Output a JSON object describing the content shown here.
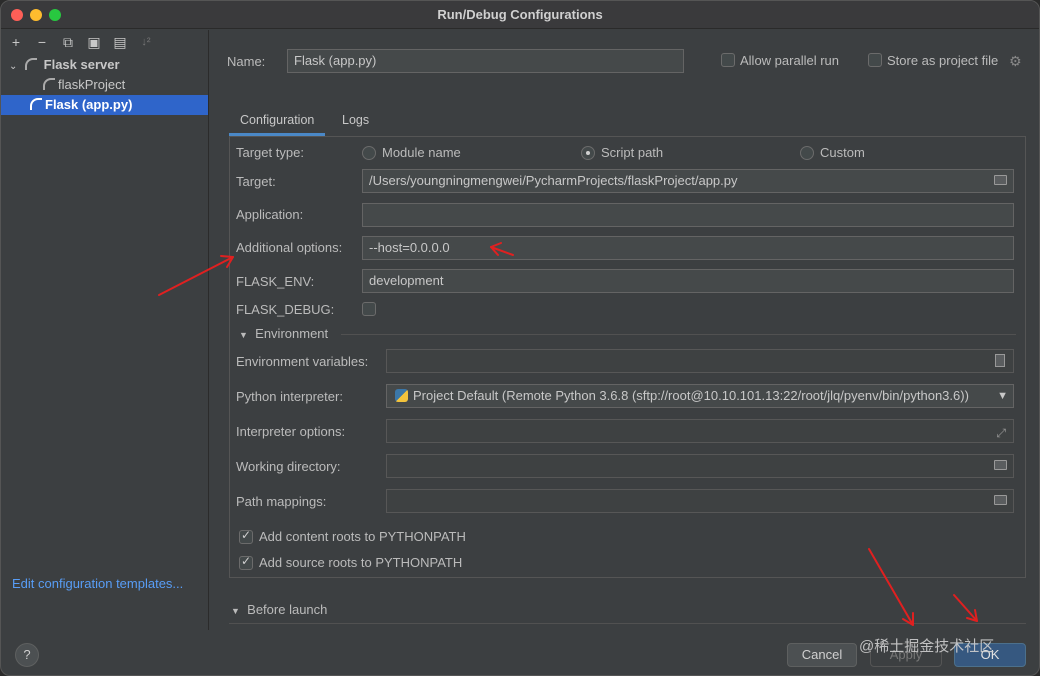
{
  "window": {
    "title": "Run/Debug Configurations"
  },
  "toolbar": {
    "icons": [
      "plus-icon",
      "minus-icon",
      "copy-icon",
      "save-icon",
      "folder-add-icon",
      "sort-icon"
    ]
  },
  "tree": {
    "group": "Flask server",
    "items": [
      "flaskProject",
      "Flask (app.py)"
    ],
    "selected": "Flask (app.py)"
  },
  "edit_templates_link": "Edit configuration templates...",
  "name_row": {
    "label": "Name:",
    "value": "Flask (app.py)",
    "allow_parallel": "Allow parallel run",
    "store_project": "Store as project file"
  },
  "tabs": [
    "Configuration",
    "Logs"
  ],
  "form": {
    "target_type_label": "Target type:",
    "radio_module": "Module name",
    "radio_script": "Script path",
    "radio_custom": "Custom",
    "target_label": "Target:",
    "target_value": "/Users/youngningmengwei/PycharmProjects/flaskProject/app.py",
    "application_label": "Application:",
    "application_value": "",
    "additional_label": "Additional options:",
    "additional_value": "--host=0.0.0.0",
    "flask_env_label": "FLASK_ENV:",
    "flask_env_value": "development",
    "flask_debug_label": "FLASK_DEBUG:"
  },
  "environment": {
    "header": "Environment",
    "env_vars_label": "Environment variables:",
    "interpreter_label": "Python interpreter:",
    "interpreter_value": "Project Default (Remote Python 3.6.8 (sftp://root@10.10.101.13:22/root/jlq/pyenv/bin/python3.6))",
    "interp_options_label": "Interpreter options:",
    "working_dir_label": "Working directory:",
    "path_mappings_label": "Path mappings:",
    "add_content_roots": "Add content roots to PYTHONPATH",
    "add_source_roots": "Add source roots to PYTHONPATH"
  },
  "before_launch": {
    "header": "Before launch"
  },
  "buttons": {
    "help": "?",
    "cancel": "Cancel",
    "apply": "Apply",
    "ok": "OK"
  },
  "watermark": "@稀土掘金技术社区",
  "colors": {
    "accent": "#2f65ca",
    "annotation_arrow": "#e02020"
  }
}
